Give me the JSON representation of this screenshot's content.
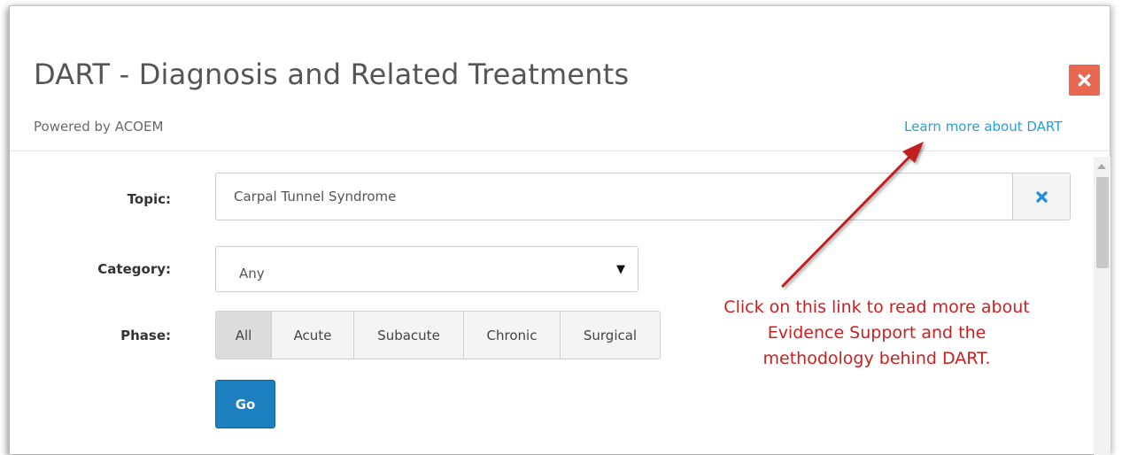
{
  "dialog": {
    "title": "DART - Diagnosis and Related Treatments",
    "subtitle": "Powered by ACOEM",
    "learn_more_link": "Learn more about DART",
    "close_icon": "close-x-icon"
  },
  "form": {
    "topic": {
      "label": "Topic:",
      "value": "Carpal Tunnel Syndrome",
      "clear_icon": "clear-x-icon"
    },
    "category": {
      "label": "Category:",
      "selected": "Any"
    },
    "phase": {
      "label": "Phase:",
      "options": [
        "All",
        "Acute",
        "Subacute",
        "Chronic",
        "Surgical"
      ],
      "selected": "All"
    },
    "go_label": "Go"
  },
  "annotation": {
    "lines": [
      "Click on this link to read more about",
      "Evidence Support and the",
      "methodology behind DART."
    ]
  },
  "colors": {
    "close_button": "#e8674f",
    "link": "#2a9fd6",
    "primary_button": "#1c7fc0",
    "annotation": "#cc1f1f",
    "clear_icon": "#2a8fd6"
  }
}
